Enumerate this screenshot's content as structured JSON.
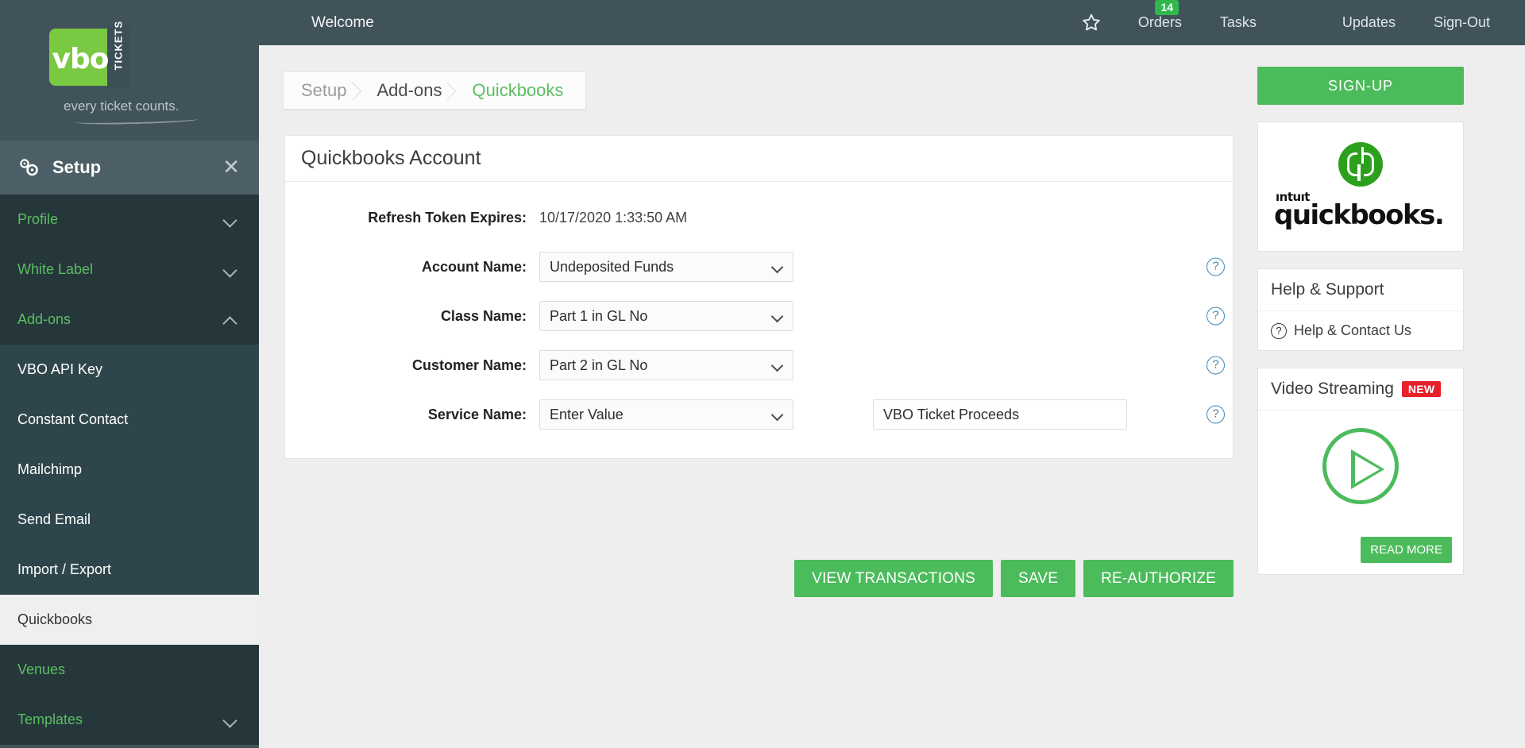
{
  "brand": {
    "logo_text": "vbo",
    "logo_sub": "TICKETS",
    "tagline": "every ticket counts."
  },
  "sidebar": {
    "header": {
      "title": "Setup",
      "gear_icon": "gears-icon",
      "close_icon": "close-icon"
    },
    "items": [
      {
        "label": "Profile",
        "type": "group",
        "chevron": "down",
        "active": false
      },
      {
        "label": "White Label",
        "type": "group",
        "chevron": "down",
        "active": false
      },
      {
        "label": "Add-ons",
        "type": "group",
        "chevron": "up",
        "active": false
      },
      {
        "label": "VBO API Key",
        "type": "sub",
        "chevron": "",
        "active": false
      },
      {
        "label": "Constant Contact",
        "type": "sub",
        "chevron": "",
        "active": false
      },
      {
        "label": "Mailchimp",
        "type": "sub",
        "chevron": "",
        "active": false
      },
      {
        "label": "Send Email",
        "type": "sub",
        "chevron": "",
        "active": false
      },
      {
        "label": "Import / Export",
        "type": "sub",
        "chevron": "",
        "active": false
      },
      {
        "label": "Quickbooks",
        "type": "sub",
        "chevron": "",
        "active": true
      },
      {
        "label": "Venues",
        "type": "group",
        "chevron": "",
        "active": false
      },
      {
        "label": "Templates",
        "type": "group",
        "chevron": "down",
        "active": false
      }
    ]
  },
  "topbar": {
    "welcome": "Welcome",
    "favorite_icon": "star-icon",
    "orders": "Orders",
    "orders_badge": "14",
    "tasks": "Tasks",
    "updates": "Updates",
    "signout": "Sign-Out"
  },
  "breadcrumb": {
    "setup": "Setup",
    "addons": "Add-ons",
    "current": "Quickbooks"
  },
  "card": {
    "title": "Quickbooks Account",
    "token_label": "Refresh Token Expires:",
    "token_value": "10/17/2020 1:33:50 AM",
    "fields": [
      {
        "label": "Account Name:",
        "value": "Undeposited Funds",
        "help": "?"
      },
      {
        "label": "Class Name:",
        "value": "Part 1 in GL No",
        "help": "?"
      },
      {
        "label": "Customer Name:",
        "value": "Part 2 in GL No",
        "help": "?"
      },
      {
        "label": "Service Name:",
        "value": "Enter Value",
        "help": "?"
      }
    ],
    "service_text_value": "VBO Ticket Proceeds",
    "service_text_placeholder": "Enter Value"
  },
  "actions": {
    "view_transactions": "VIEW TRANSACTIONS",
    "save": "SAVE",
    "reauthorize": "RE-AUTHORIZE"
  },
  "rail": {
    "signup": "SIGN-UP",
    "qb_intuit": "ıntuıt",
    "qb_word": "quickbooks.",
    "help_title": "Help & Support",
    "help_link": "Help & Contact Us",
    "help_icon": "question-circle-icon",
    "video_title": "Video Streaming",
    "video_badge": "NEW",
    "play_icon": "play-circle-icon",
    "read_more": "READ MORE"
  },
  "colors": {
    "brand_green": "#4cbb5c",
    "sidebar_dark": "#41535a",
    "nav_group_bg": "#25373b",
    "nav_sub_bg": "#2e464b",
    "badge_red": "#e8202a",
    "help_blue": "#3d87b8",
    "qb_green": "#2ca01c"
  }
}
